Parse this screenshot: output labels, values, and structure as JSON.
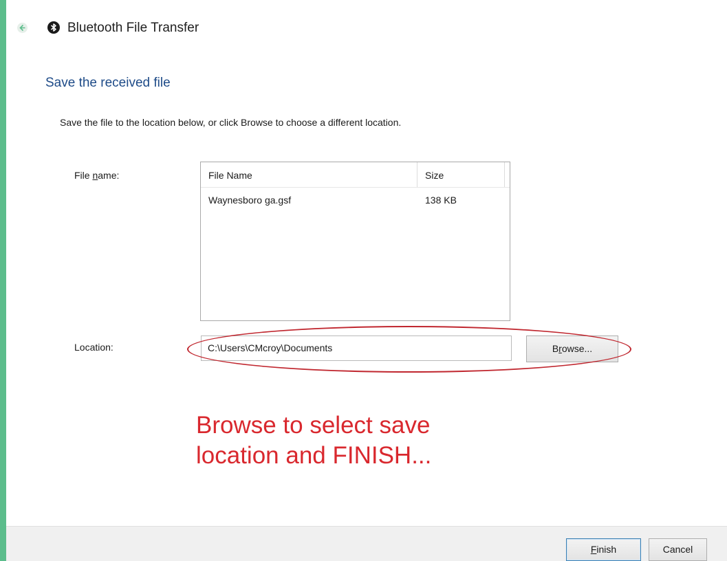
{
  "window": {
    "title": "Bluetooth File Transfer"
  },
  "page": {
    "heading": "Save the received file",
    "instruction": "Save the file to the location below, or click Browse to choose a different location."
  },
  "file_list": {
    "label_pre": "File ",
    "label_accel": "n",
    "label_post": "ame:",
    "columns": [
      "File Name",
      "Size"
    ],
    "rows": [
      {
        "name": "Waynesboro ga.gsf",
        "size": "138 KB"
      }
    ]
  },
  "location": {
    "label": "Location:",
    "value": "C:\\Users\\CMcroy\\Documents",
    "browse_pre": "B",
    "browse_accel": "r",
    "browse_post": "owse..."
  },
  "annotation": {
    "line1": "Browse to select save",
    "line2": "location and FINISH..."
  },
  "footer": {
    "finish_accel": "F",
    "finish_post": "inish",
    "cancel_label": "Cancel"
  },
  "colors": {
    "titlebar": "#5cbd8c",
    "heading": "#1e4b88",
    "annotation": "#d9282e"
  },
  "icons": {
    "back": "back-arrow-icon",
    "bluetooth": "bluetooth-icon"
  }
}
